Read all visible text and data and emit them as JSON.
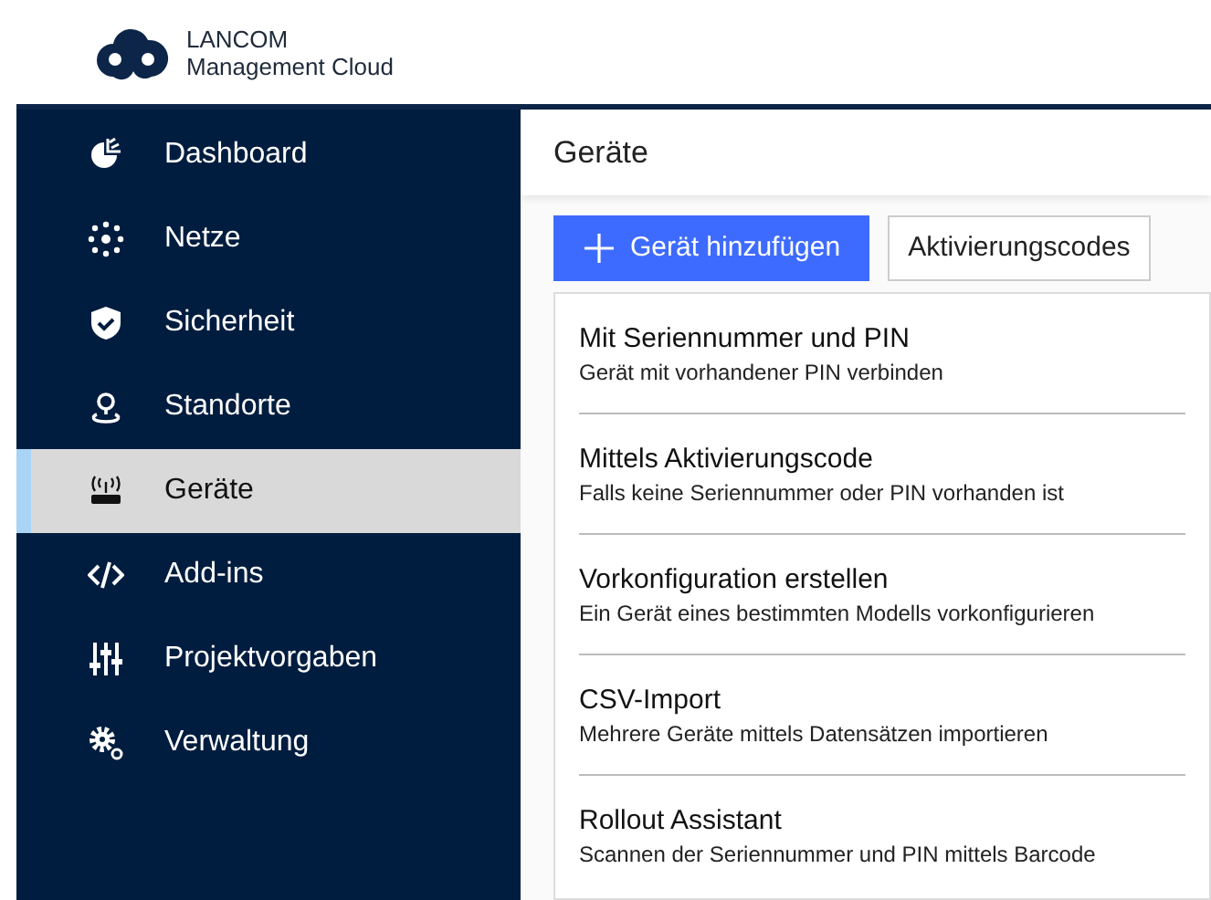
{
  "logo": {
    "line_1": "LANCOM",
    "line_2": "Management Cloud"
  },
  "sidebar": {
    "items": [
      {
        "label": "Dashboard",
        "selected": false
      },
      {
        "label": "Netze",
        "selected": false
      },
      {
        "label": "Sicherheit",
        "selected": false
      },
      {
        "label": "Standorte",
        "selected": false
      },
      {
        "label": "Geräte",
        "selected": true
      },
      {
        "label": "Add-ins",
        "selected": false
      },
      {
        "label": "Projektvorgaben",
        "selected": false
      },
      {
        "label": "Verwaltung",
        "selected": false
      }
    ]
  },
  "page_title": "Geräte",
  "toolbar": {
    "add_button": "Gerät hinzufügen",
    "codes_button": "Aktivierungscodes"
  },
  "menu": [
    {
      "title": "Mit Seriennummer und PIN",
      "description": "Gerät mit vorhandener PIN verbinden"
    },
    {
      "title": "Mittels Aktivierungscode",
      "description": "Falls keine Seriennummer oder PIN vorhanden ist"
    },
    {
      "title": "Vorkonfiguration erstellen",
      "description": "Ein Gerät eines bestimmten Modells vorkonfigurieren"
    },
    {
      "title": "CSV-Import",
      "description": "Mehrere Geräte mittels Datensätzen importieren"
    },
    {
      "title": "Rollout Assistant",
      "description": "Scannen der Seriennummer und PIN mittels Barcode"
    }
  ]
}
